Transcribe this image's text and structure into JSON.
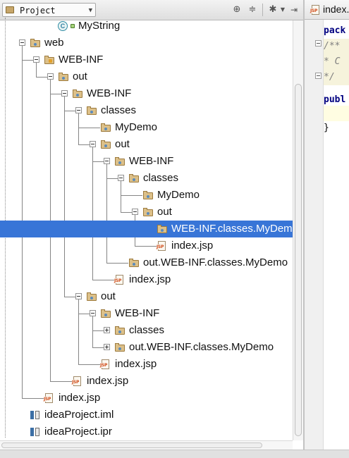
{
  "project_panel": {
    "view_selector": "Project",
    "header_icons": [
      "target-icon",
      "collapse-all-icon",
      "settings-icon",
      "hide-panel-icon"
    ],
    "tree": [
      {
        "label": "MyString",
        "icon": "class-icon",
        "depth": 3
      },
      {
        "label": "web",
        "icon": "folder-icon",
        "depth": 1,
        "toggle": "expanded"
      },
      {
        "label": "WEB-INF",
        "icon": "web-folder-icon",
        "depth": 2,
        "toggle": "expanded"
      },
      {
        "label": "out",
        "icon": "folder-icon",
        "depth": 3,
        "toggle": "expanded"
      },
      {
        "label": "WEB-INF",
        "icon": "folder-icon",
        "depth": 4,
        "toggle": "expanded"
      },
      {
        "label": "classes",
        "icon": "folder-icon",
        "depth": 5,
        "toggle": "expanded"
      },
      {
        "label": "MyDemo",
        "icon": "folder-icon",
        "depth": 6
      },
      {
        "label": "out",
        "icon": "folder-icon",
        "depth": 6,
        "toggle": "expanded"
      },
      {
        "label": "WEB-INF",
        "icon": "folder-icon",
        "depth": 7,
        "toggle": "expanded"
      },
      {
        "label": "classes",
        "icon": "folder-icon",
        "depth": 8,
        "toggle": "expanded"
      },
      {
        "label": "MyDemo",
        "icon": "folder-icon",
        "depth": 9
      },
      {
        "label": "out",
        "icon": "folder-icon",
        "depth": 9,
        "toggle": "expanded"
      },
      {
        "label": "WEB-INF.classes.MyDemo",
        "icon": "folder-icon",
        "depth": 10,
        "selected": true
      },
      {
        "label": "index.jsp",
        "icon": "jsp-icon",
        "depth": 10
      },
      {
        "label": "out.WEB-INF.classes.MyDemo",
        "icon": "folder-icon",
        "depth": 8
      },
      {
        "label": "index.jsp",
        "icon": "jsp-icon",
        "depth": 7
      },
      {
        "label": "out",
        "icon": "folder-icon",
        "depth": 5,
        "toggle": "expanded"
      },
      {
        "label": "WEB-INF",
        "icon": "folder-icon",
        "depth": 6,
        "toggle": "expanded"
      },
      {
        "label": "classes",
        "icon": "folder-icon",
        "depth": 7,
        "toggle": "collapsed"
      },
      {
        "label": "out.WEB-INF.classes.MyDemo",
        "icon": "folder-icon",
        "depth": 7,
        "toggle": "collapsed"
      },
      {
        "label": "index.jsp",
        "icon": "jsp-icon",
        "depth": 6
      },
      {
        "label": "index.jsp",
        "icon": "jsp-icon",
        "depth": 4
      },
      {
        "label": "index.jsp",
        "icon": "jsp-icon",
        "depth": 2
      },
      {
        "label": "ideaProject.iml",
        "icon": "iml-icon",
        "depth": 1
      },
      {
        "label": "ideaProject.ipr",
        "icon": "ipr-icon",
        "depth": 1
      }
    ]
  },
  "editor": {
    "tab_label": "index.",
    "code_lines": [
      {
        "text": "pack",
        "style": "kw"
      },
      {
        "text": "/**",
        "style": "comment"
      },
      {
        "text": " * C",
        "style": "comment"
      },
      {
        "text": " */",
        "style": "comment"
      },
      {
        "text": "",
        "style": "plain"
      },
      {
        "text": "publ",
        "style": "kw"
      },
      {
        "text": "",
        "style": "plain"
      },
      {
        "text": "}",
        "style": "plain"
      }
    ]
  },
  "colors": {
    "selection": "#3875d7",
    "folder": "#dcc089",
    "keyword": "#000080",
    "comment": "#808080"
  }
}
